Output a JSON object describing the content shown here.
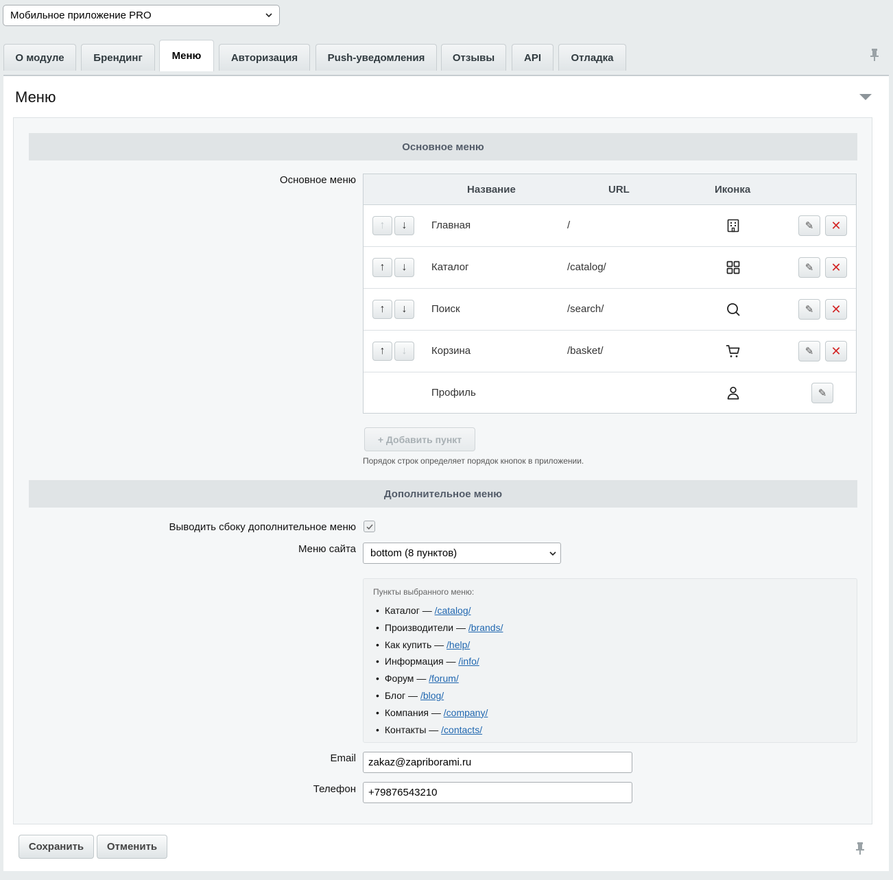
{
  "module_select": {
    "value": "Мобильное приложение PRO"
  },
  "tabs": [
    {
      "label": "О модуле",
      "active": false
    },
    {
      "label": "Брендинг",
      "active": false
    },
    {
      "label": "Меню",
      "active": true
    },
    {
      "label": "Авторизация",
      "active": false
    },
    {
      "label": "Push-уведомления",
      "active": false
    },
    {
      "label": "Отзывы",
      "active": false
    },
    {
      "label": "API",
      "active": false
    },
    {
      "label": "Отладка",
      "active": false
    }
  ],
  "panel": {
    "title": "Меню"
  },
  "main_menu": {
    "section_title": "Основное меню",
    "field_label": "Основное меню",
    "columns": {
      "name": "Название",
      "url": "URL",
      "icon": "Иконка"
    },
    "rows": [
      {
        "name": "Главная",
        "url": "/",
        "icon": "building-icon",
        "up_enabled": false,
        "down_enabled": true,
        "deletable": true,
        "movable": true
      },
      {
        "name": "Каталог",
        "url": "/catalog/",
        "icon": "grid-icon",
        "up_enabled": true,
        "down_enabled": true,
        "deletable": true,
        "movable": true
      },
      {
        "name": "Поиск",
        "url": "/search/",
        "icon": "search-icon",
        "up_enabled": true,
        "down_enabled": true,
        "deletable": true,
        "movable": true
      },
      {
        "name": "Корзина",
        "url": "/basket/",
        "icon": "cart-icon",
        "up_enabled": true,
        "down_enabled": false,
        "deletable": true,
        "movable": true
      },
      {
        "name": "Профиль",
        "url": "",
        "icon": "user-icon",
        "up_enabled": false,
        "down_enabled": false,
        "deletable": false,
        "movable": false
      }
    ],
    "arrow_up": "↑",
    "arrow_down": "↓",
    "edit_glyph": "✎",
    "delete_glyph": "✕",
    "add_button": "+ Добавить пункт",
    "hint": "Порядок строк определяет порядок кнопок в приложении."
  },
  "extra_menu": {
    "section_title": "Дополнительное меню",
    "side_menu_label": "Выводить сбоку дополнительное меню",
    "side_menu_checked": true,
    "site_menu_label": "Меню сайта",
    "site_menu_value": "bottom (8 пунктов)",
    "items_caption": "Пункты выбранного меню:",
    "items": [
      {
        "name": "Каталог",
        "url": "/catalog/"
      },
      {
        "name": "Производители",
        "url": "/brands/"
      },
      {
        "name": "Как купить",
        "url": "/help/"
      },
      {
        "name": "Информация",
        "url": "/info/"
      },
      {
        "name": "Форум",
        "url": "/forum/"
      },
      {
        "name": "Блог",
        "url": "/blog/"
      },
      {
        "name": "Компания",
        "url": "/company/"
      },
      {
        "name": "Контакты",
        "url": "/contacts/"
      }
    ],
    "separator": "—",
    "email_label": "Email",
    "email_value": "zakaz@zapriborami.ru",
    "phone_label": "Телефон",
    "phone_value": "+79876543210"
  },
  "footer": {
    "save_label": "Сохранить",
    "cancel_label": "Отменить"
  },
  "colors": {
    "delete": "#d32626",
    "link": "#2067b0",
    "section_bg": "#e0e4e6"
  }
}
